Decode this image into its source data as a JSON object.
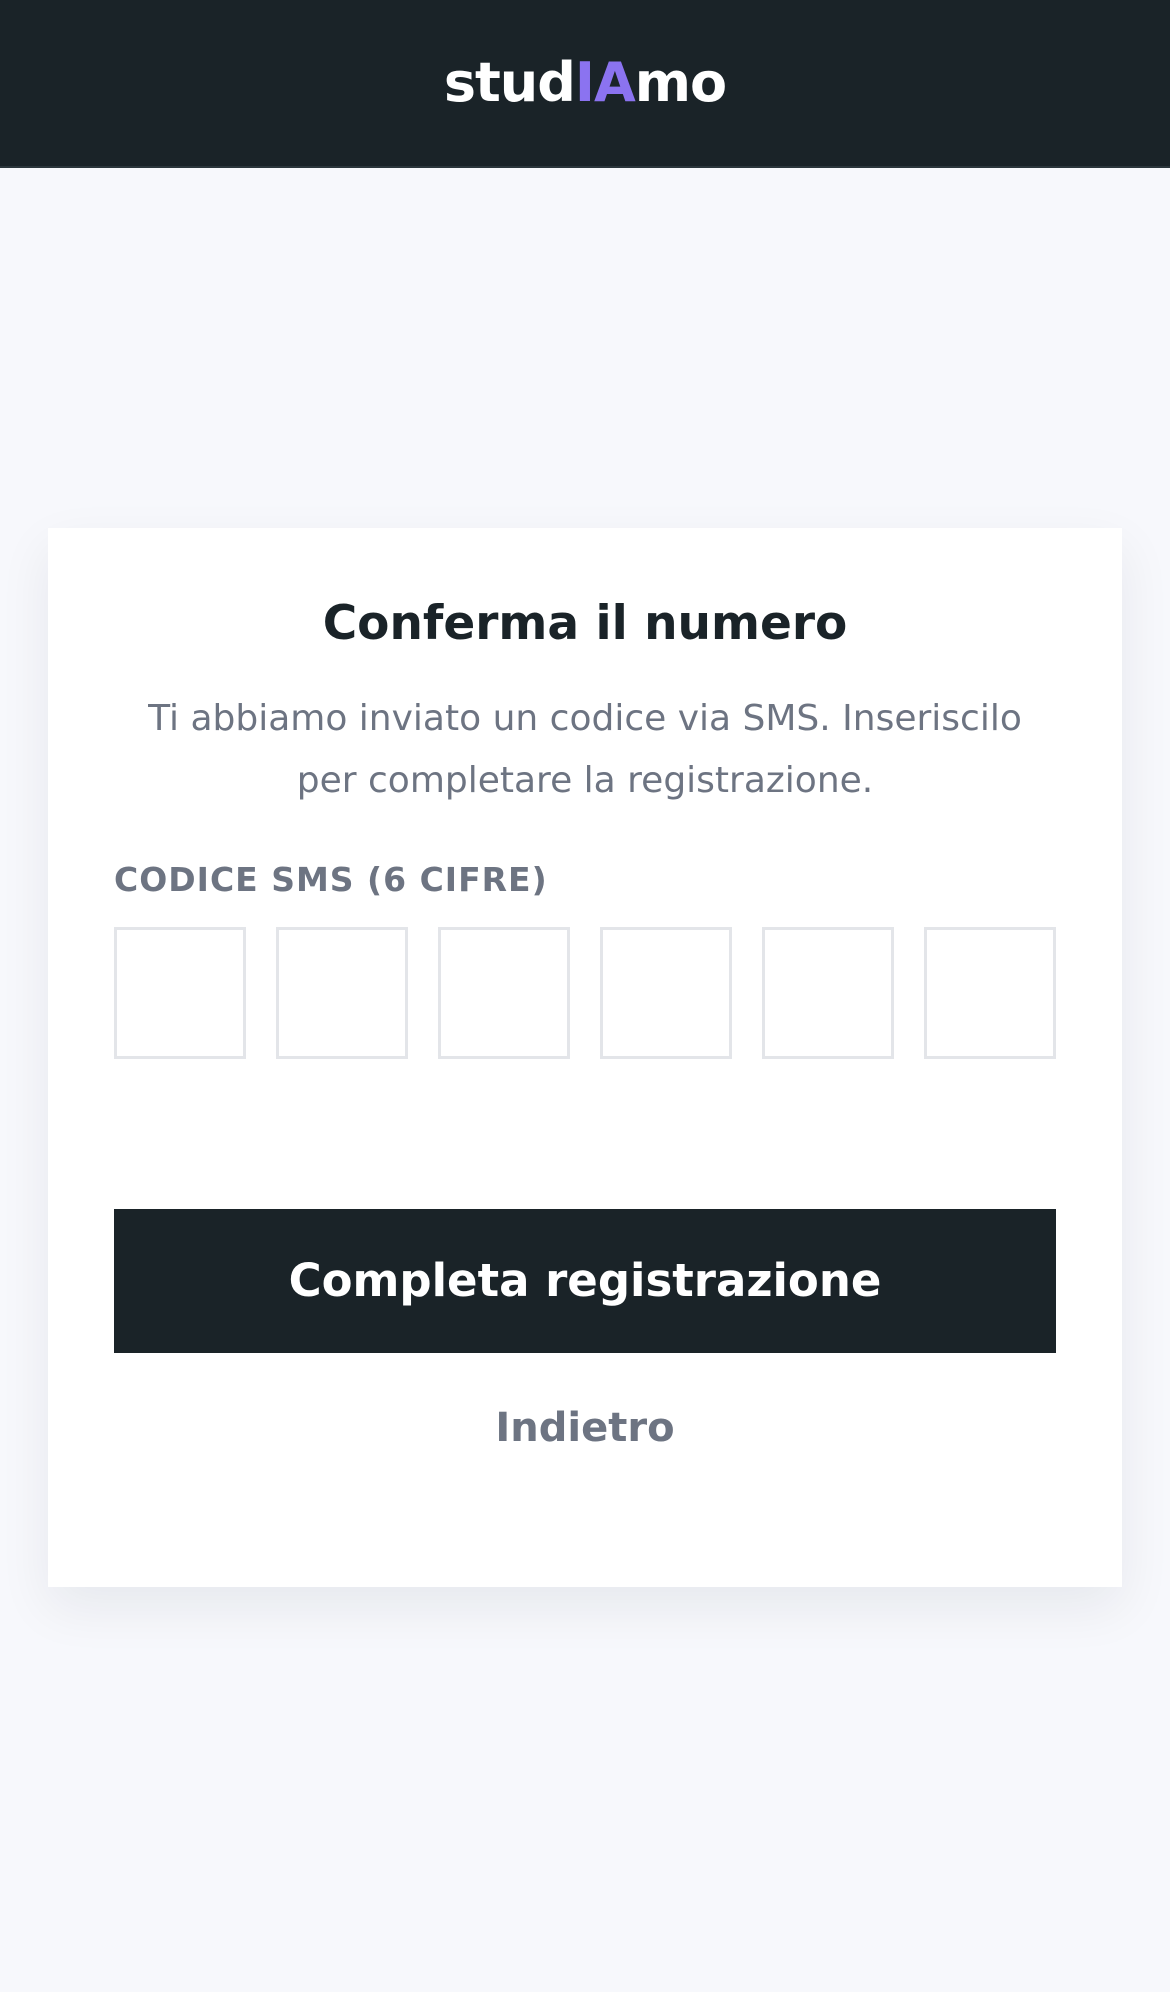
{
  "header": {
    "logo": {
      "part1": "stud",
      "accent": "IA",
      "part2": "mo",
      "accent_color": "#8b73f0"
    }
  },
  "card": {
    "title": "Conferma il numero",
    "description": "Ti abbiamo inviato un codice via SMS. Inseriscilo per completare la registrazione.",
    "code_label": "CODICE SMS (6 CIFRE)",
    "code_digits": [
      "",
      "",
      "",
      "",
      "",
      ""
    ],
    "submit_label": "Completa registrazione",
    "back_label": "Indietro"
  },
  "colors": {
    "header_bg": "#1a2328",
    "page_bg": "#f7f8fc",
    "muted_text": "#6d7482",
    "input_border": "#e3e5e9"
  }
}
